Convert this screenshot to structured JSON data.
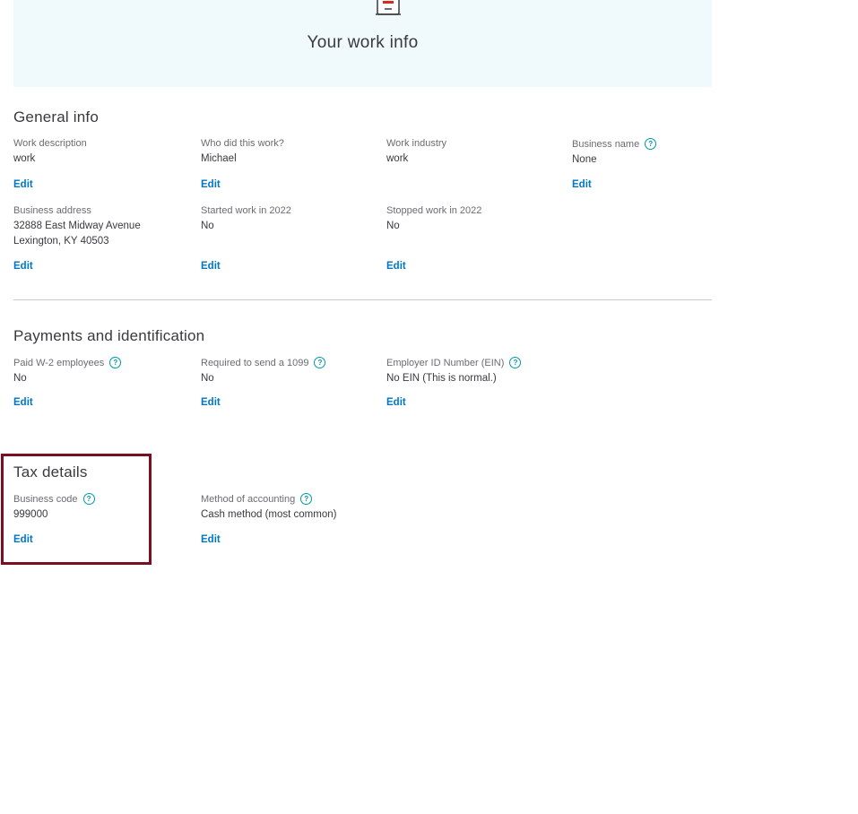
{
  "header": {
    "title": "Your work info",
    "icon": "laptop-briefcase-icon"
  },
  "general_info": {
    "title": "General info",
    "fields": [
      {
        "label": "Work description",
        "value": "work",
        "edit": "Edit",
        "help": false
      },
      {
        "label": "Who did this work?",
        "value": "Michael",
        "edit": "Edit",
        "help": false
      },
      {
        "label": "Work industry",
        "value": "work",
        "edit": "",
        "help": false
      },
      {
        "label": "Business name",
        "value": "None",
        "edit": "Edit",
        "help": true
      },
      {
        "label": "Business address",
        "value": "32888 East Midway Avenue",
        "value2": "Lexington, KY 40503",
        "edit": "Edit",
        "help": false
      },
      {
        "label": "Started work in 2022",
        "value": "No",
        "edit": "Edit",
        "help": false
      },
      {
        "label": "Stopped work in 2022",
        "value": "No",
        "edit": "Edit",
        "help": false
      }
    ]
  },
  "payments": {
    "title": "Payments and identification",
    "fields": [
      {
        "label": "Paid W-2 employees",
        "value": "No",
        "edit": "Edit",
        "help": true
      },
      {
        "label": "Required to send a 1099",
        "value": "No",
        "edit": "Edit",
        "help": true
      },
      {
        "label": "Employer ID Number (EIN)",
        "value": "No EIN (This is normal.)",
        "edit": "Edit",
        "help": true
      }
    ]
  },
  "tax_details": {
    "title": "Tax details",
    "fields": [
      {
        "label": "Business code",
        "value": "999000",
        "edit": "Edit",
        "help": true
      },
      {
        "label": "Method of accounting",
        "value": "Cash method (most common)",
        "edit": "Edit",
        "help": true
      }
    ]
  },
  "help_glyph": "?",
  "colors": {
    "hero_bg": "#f0f9fb",
    "link": "#0077c5",
    "help": "#0097a7",
    "highlight": "#7a0f21"
  }
}
